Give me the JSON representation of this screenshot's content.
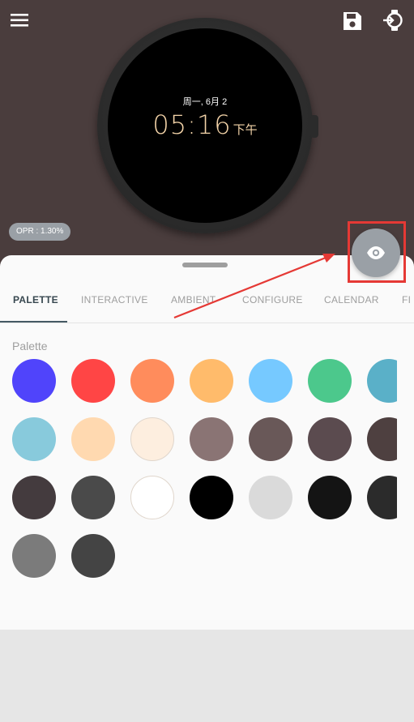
{
  "header": {
    "menu_icon": "hamburger-menu-icon",
    "save_icon": "floppy-save-icon",
    "sync_icon": "watch-sync-icon"
  },
  "watch": {
    "date": "周一, 6月 2",
    "time": "05:16",
    "ampm": "下午"
  },
  "opr_badge": "OPR : 1.30%",
  "fab_icon": "eye-preview-icon",
  "tabs": [
    {
      "label": "PALETTE",
      "active": true
    },
    {
      "label": "INTERACTIVE",
      "active": false
    },
    {
      "label": "AMBIENT",
      "active": false
    },
    {
      "label": "CONFIGURE",
      "active": false
    },
    {
      "label": "CALENDAR",
      "active": false
    },
    {
      "label": "FI",
      "active": false
    }
  ],
  "palette": {
    "label": "Palette",
    "colors": [
      "#5044fb",
      "#ff4545",
      "#ff8c5c",
      "#ffbb6b",
      "#76c9ff",
      "#4cc88c",
      "#5ab0c8",
      "#88cadc",
      "#ffd9b0",
      "#fdeedf",
      "#8a7474",
      "#695858",
      "#5b4b4f",
      "#4e4040",
      "#443b3e",
      "#4a4a4a",
      "#ffffff",
      "#000000",
      "#dadada",
      "#141414",
      "#2b2b2b",
      "#7b7b7b",
      "#444444"
    ]
  },
  "annotation": {
    "color": "#e53935"
  }
}
